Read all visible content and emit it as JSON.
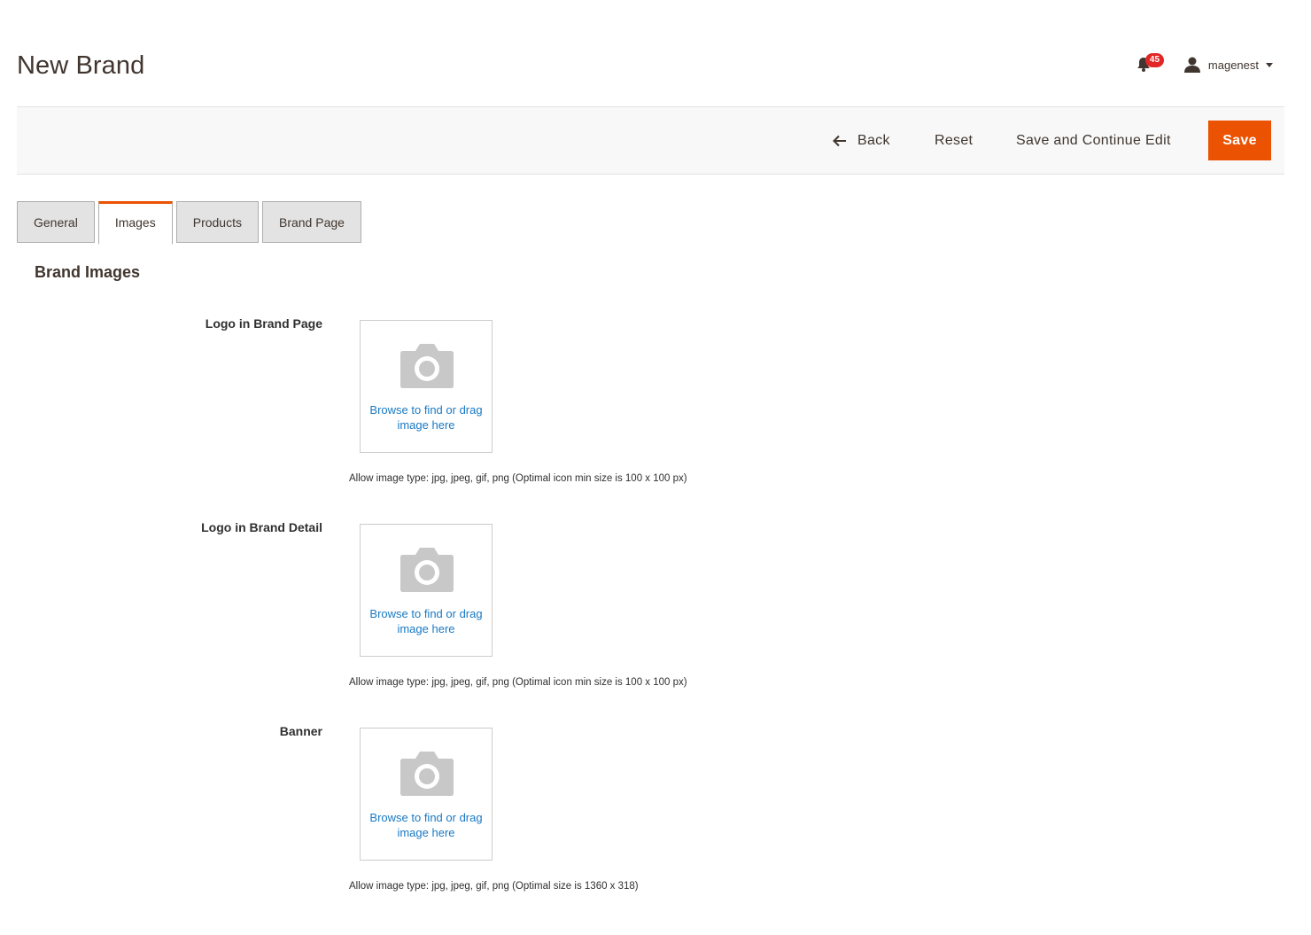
{
  "header": {
    "title": "New Brand",
    "notifications_count": "45",
    "user_name": "magenest"
  },
  "toolbar": {
    "back_label": "Back",
    "reset_label": "Reset",
    "save_continue_label": "Save and Continue Edit",
    "save_label": "Save"
  },
  "tabs": [
    {
      "label": "General"
    },
    {
      "label": "Images"
    },
    {
      "label": "Products"
    },
    {
      "label": "Brand Page"
    }
  ],
  "section": {
    "title": "Brand Images"
  },
  "fields": [
    {
      "label": "Logo in Brand Page",
      "upload_text": "Browse to find or drag image here",
      "note": "Allow image type: jpg, jpeg, gif, png (Optimal icon min size is 100 x 100 px)"
    },
    {
      "label": "Logo in Brand Detail",
      "upload_text": "Browse to find or drag image here",
      "note": "Allow image type: jpg, jpeg, gif, png (Optimal icon min size is 100 x 100 px)"
    },
    {
      "label": "Banner",
      "upload_text": "Browse to find or drag image here",
      "note": "Allow image type: jpg, jpeg, gif, png (Optimal size is 1360 x 318)"
    }
  ],
  "colors": {
    "accent": "#eb5202",
    "link": "#1979c3",
    "badge": "#e22626"
  }
}
